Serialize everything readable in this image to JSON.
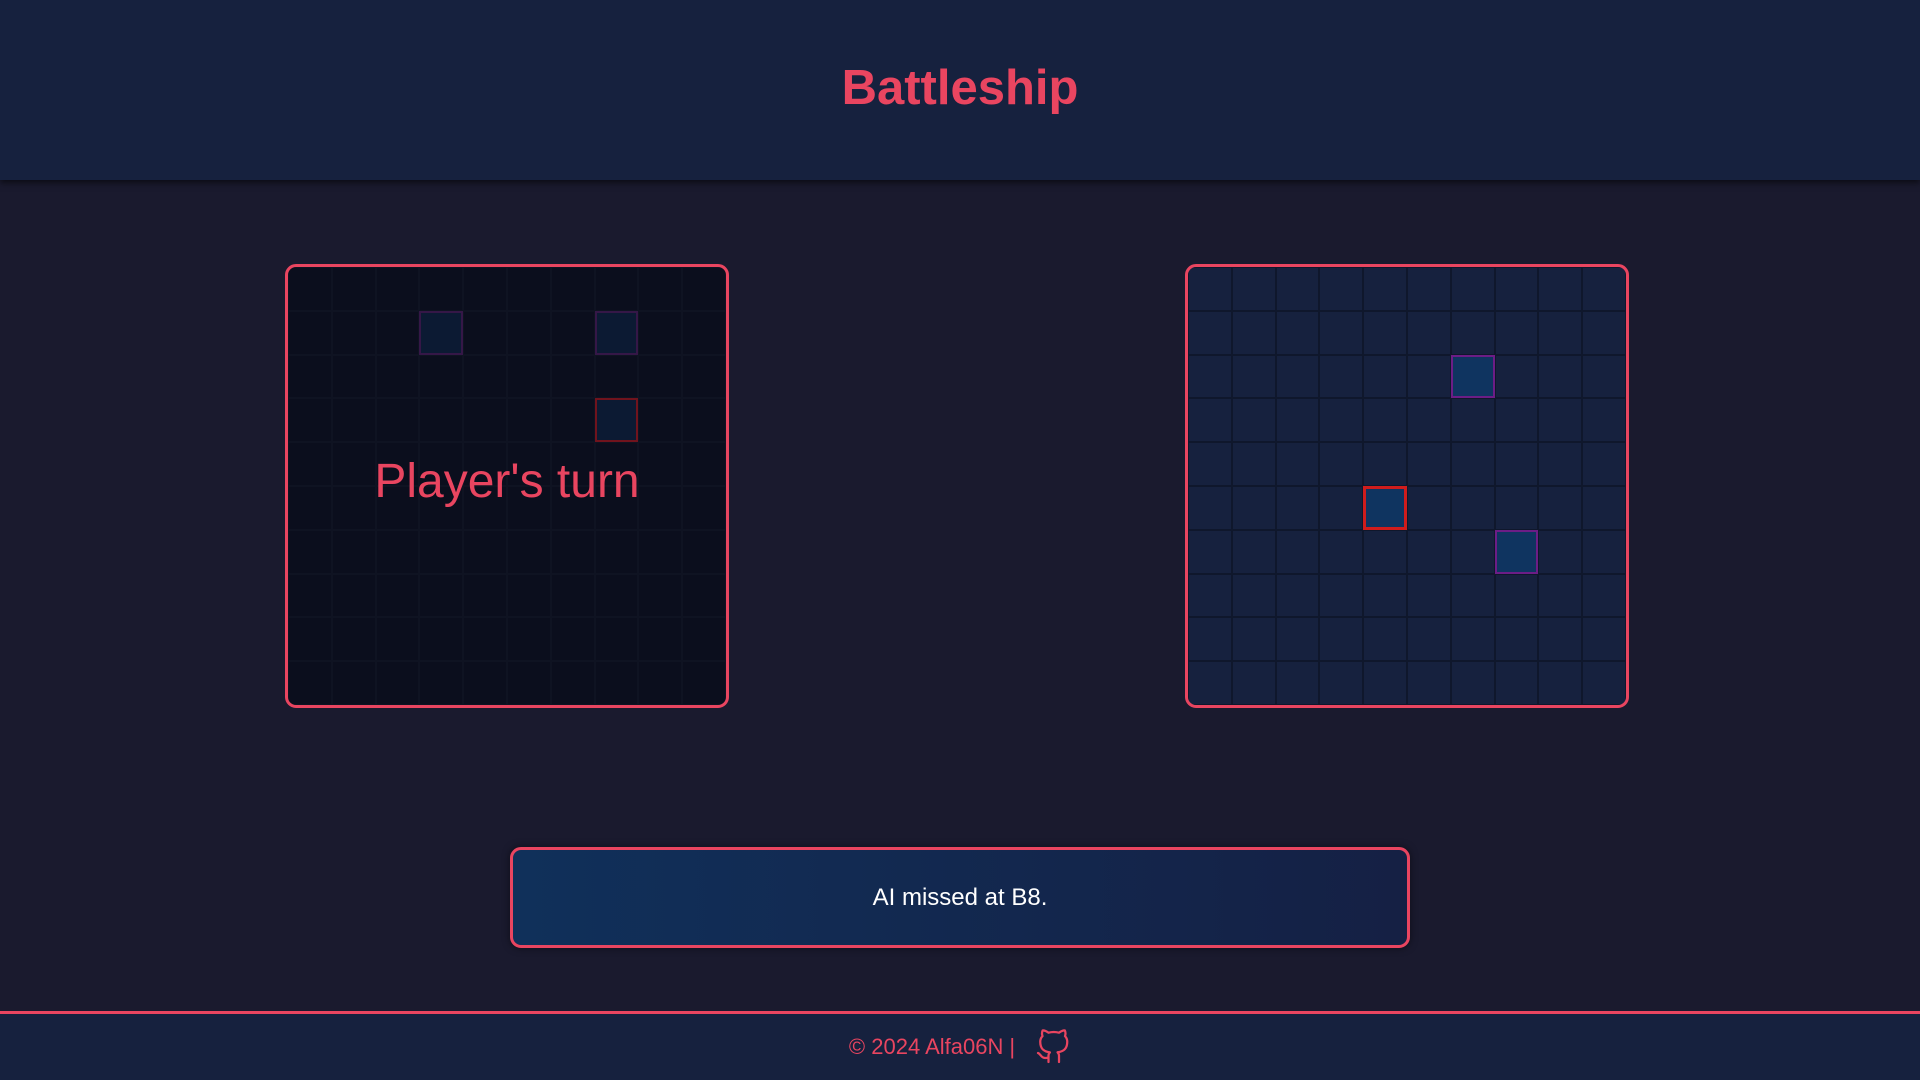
{
  "header": {
    "title": "Battleship"
  },
  "player_board": {
    "overlay_text": "Player's turn",
    "rows": 10,
    "cols": 10,
    "ship_cells": [
      [
        1,
        3
      ],
      [
        1,
        7
      ]
    ],
    "hit_cells": [
      [
        3,
        7
      ]
    ]
  },
  "enemy_board": {
    "rows": 10,
    "cols": 10,
    "ship_cells": [
      [
        2,
        6
      ],
      [
        6,
        7
      ]
    ],
    "hit_cells": [
      [
        5,
        4
      ]
    ]
  },
  "message": {
    "text": "AI missed at B8."
  },
  "footer": {
    "copyright": "© 2024 Alfa06N",
    "separator": "|",
    "link_icon": "github-icon"
  },
  "colors": {
    "accent": "#e94560",
    "header_bg": "#16213e",
    "page_bg": "#1a1a2e",
    "ship": "#0f3460",
    "ship_border": "#6c1d86",
    "hit_border": "#d01c1c"
  }
}
